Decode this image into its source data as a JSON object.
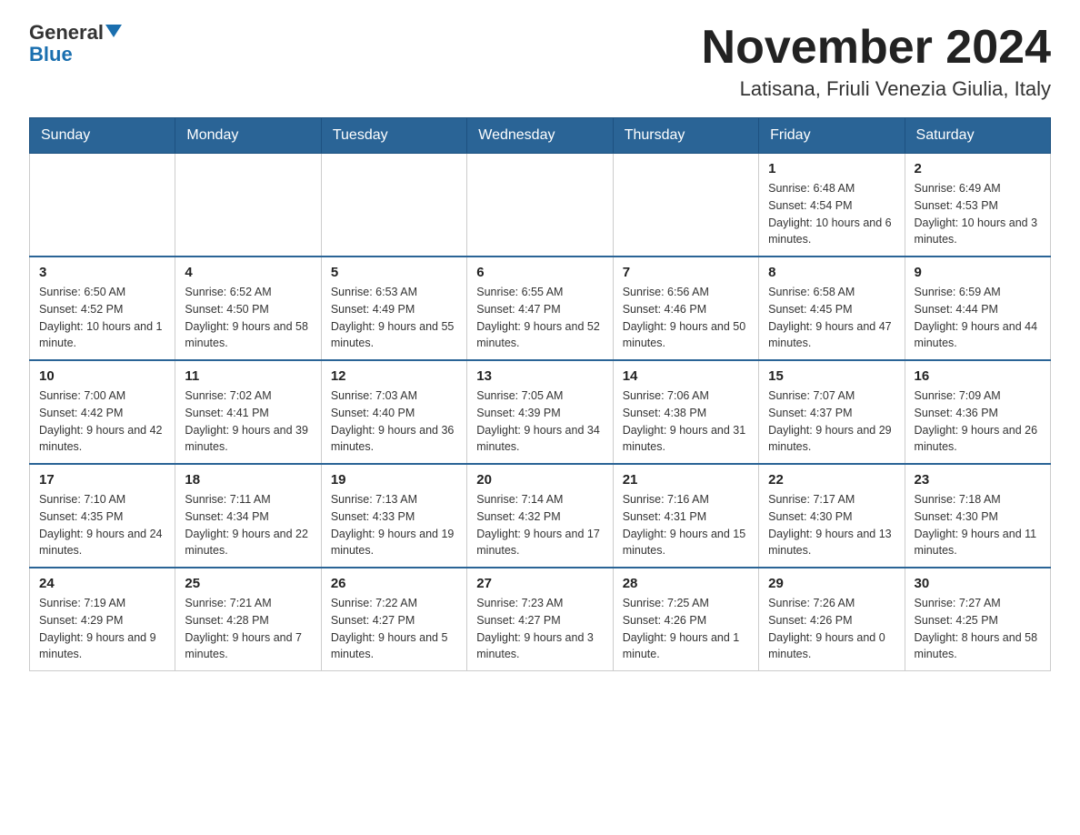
{
  "header": {
    "logo_general": "General",
    "logo_blue": "Blue",
    "title": "November 2024",
    "subtitle": "Latisana, Friuli Venezia Giulia, Italy"
  },
  "weekdays": [
    "Sunday",
    "Monday",
    "Tuesday",
    "Wednesday",
    "Thursday",
    "Friday",
    "Saturday"
  ],
  "weeks": [
    [
      {
        "day": "",
        "info": ""
      },
      {
        "day": "",
        "info": ""
      },
      {
        "day": "",
        "info": ""
      },
      {
        "day": "",
        "info": ""
      },
      {
        "day": "",
        "info": ""
      },
      {
        "day": "1",
        "info": "Sunrise: 6:48 AM\nSunset: 4:54 PM\nDaylight: 10 hours and 6 minutes."
      },
      {
        "day": "2",
        "info": "Sunrise: 6:49 AM\nSunset: 4:53 PM\nDaylight: 10 hours and 3 minutes."
      }
    ],
    [
      {
        "day": "3",
        "info": "Sunrise: 6:50 AM\nSunset: 4:52 PM\nDaylight: 10 hours and 1 minute."
      },
      {
        "day": "4",
        "info": "Sunrise: 6:52 AM\nSunset: 4:50 PM\nDaylight: 9 hours and 58 minutes."
      },
      {
        "day": "5",
        "info": "Sunrise: 6:53 AM\nSunset: 4:49 PM\nDaylight: 9 hours and 55 minutes."
      },
      {
        "day": "6",
        "info": "Sunrise: 6:55 AM\nSunset: 4:47 PM\nDaylight: 9 hours and 52 minutes."
      },
      {
        "day": "7",
        "info": "Sunrise: 6:56 AM\nSunset: 4:46 PM\nDaylight: 9 hours and 50 minutes."
      },
      {
        "day": "8",
        "info": "Sunrise: 6:58 AM\nSunset: 4:45 PM\nDaylight: 9 hours and 47 minutes."
      },
      {
        "day": "9",
        "info": "Sunrise: 6:59 AM\nSunset: 4:44 PM\nDaylight: 9 hours and 44 minutes."
      }
    ],
    [
      {
        "day": "10",
        "info": "Sunrise: 7:00 AM\nSunset: 4:42 PM\nDaylight: 9 hours and 42 minutes."
      },
      {
        "day": "11",
        "info": "Sunrise: 7:02 AM\nSunset: 4:41 PM\nDaylight: 9 hours and 39 minutes."
      },
      {
        "day": "12",
        "info": "Sunrise: 7:03 AM\nSunset: 4:40 PM\nDaylight: 9 hours and 36 minutes."
      },
      {
        "day": "13",
        "info": "Sunrise: 7:05 AM\nSunset: 4:39 PM\nDaylight: 9 hours and 34 minutes."
      },
      {
        "day": "14",
        "info": "Sunrise: 7:06 AM\nSunset: 4:38 PM\nDaylight: 9 hours and 31 minutes."
      },
      {
        "day": "15",
        "info": "Sunrise: 7:07 AM\nSunset: 4:37 PM\nDaylight: 9 hours and 29 minutes."
      },
      {
        "day": "16",
        "info": "Sunrise: 7:09 AM\nSunset: 4:36 PM\nDaylight: 9 hours and 26 minutes."
      }
    ],
    [
      {
        "day": "17",
        "info": "Sunrise: 7:10 AM\nSunset: 4:35 PM\nDaylight: 9 hours and 24 minutes."
      },
      {
        "day": "18",
        "info": "Sunrise: 7:11 AM\nSunset: 4:34 PM\nDaylight: 9 hours and 22 minutes."
      },
      {
        "day": "19",
        "info": "Sunrise: 7:13 AM\nSunset: 4:33 PM\nDaylight: 9 hours and 19 minutes."
      },
      {
        "day": "20",
        "info": "Sunrise: 7:14 AM\nSunset: 4:32 PM\nDaylight: 9 hours and 17 minutes."
      },
      {
        "day": "21",
        "info": "Sunrise: 7:16 AM\nSunset: 4:31 PM\nDaylight: 9 hours and 15 minutes."
      },
      {
        "day": "22",
        "info": "Sunrise: 7:17 AM\nSunset: 4:30 PM\nDaylight: 9 hours and 13 minutes."
      },
      {
        "day": "23",
        "info": "Sunrise: 7:18 AM\nSunset: 4:30 PM\nDaylight: 9 hours and 11 minutes."
      }
    ],
    [
      {
        "day": "24",
        "info": "Sunrise: 7:19 AM\nSunset: 4:29 PM\nDaylight: 9 hours and 9 minutes."
      },
      {
        "day": "25",
        "info": "Sunrise: 7:21 AM\nSunset: 4:28 PM\nDaylight: 9 hours and 7 minutes."
      },
      {
        "day": "26",
        "info": "Sunrise: 7:22 AM\nSunset: 4:27 PM\nDaylight: 9 hours and 5 minutes."
      },
      {
        "day": "27",
        "info": "Sunrise: 7:23 AM\nSunset: 4:27 PM\nDaylight: 9 hours and 3 minutes."
      },
      {
        "day": "28",
        "info": "Sunrise: 7:25 AM\nSunset: 4:26 PM\nDaylight: 9 hours and 1 minute."
      },
      {
        "day": "29",
        "info": "Sunrise: 7:26 AM\nSunset: 4:26 PM\nDaylight: 9 hours and 0 minutes."
      },
      {
        "day": "30",
        "info": "Sunrise: 7:27 AM\nSunset: 4:25 PM\nDaylight: 8 hours and 58 minutes."
      }
    ]
  ]
}
